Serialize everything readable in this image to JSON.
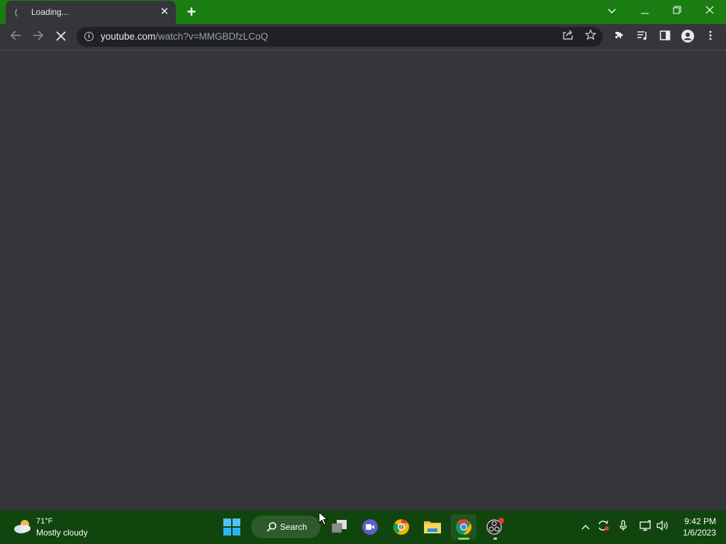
{
  "browser": {
    "tab": {
      "title": "Loading..."
    },
    "window_controls": [
      "minimize",
      "restore",
      "close"
    ],
    "address": {
      "host": "youtube.com",
      "path": "/watch?v=MMGBDfzLCoQ"
    },
    "icons": {
      "back": "arrow-left-icon",
      "forward": "arrow-right-icon",
      "stop": "close-icon",
      "share": "share-icon",
      "bookmark": "star-icon",
      "extensions": "puzzle-icon",
      "media": "media-queue-icon",
      "side_panel": "side-panel-icon",
      "profile": "profile-icon",
      "menu": "more-vert-icon"
    },
    "colors": {
      "frame": "#1a7d12",
      "toolbar": "#35363a",
      "omnibox": "#202124"
    }
  },
  "taskbar": {
    "weather": {
      "temp": "71°F",
      "desc": "Mostly cloudy"
    },
    "search_label": "Search",
    "apps": [
      "start",
      "search",
      "task-view",
      "meet",
      "chrome-canary",
      "file-explorer",
      "chrome",
      "obs"
    ],
    "clock": {
      "time": "9:42 PM",
      "date": "1/6/2023"
    },
    "colors": {
      "background": "#11450e"
    }
  }
}
